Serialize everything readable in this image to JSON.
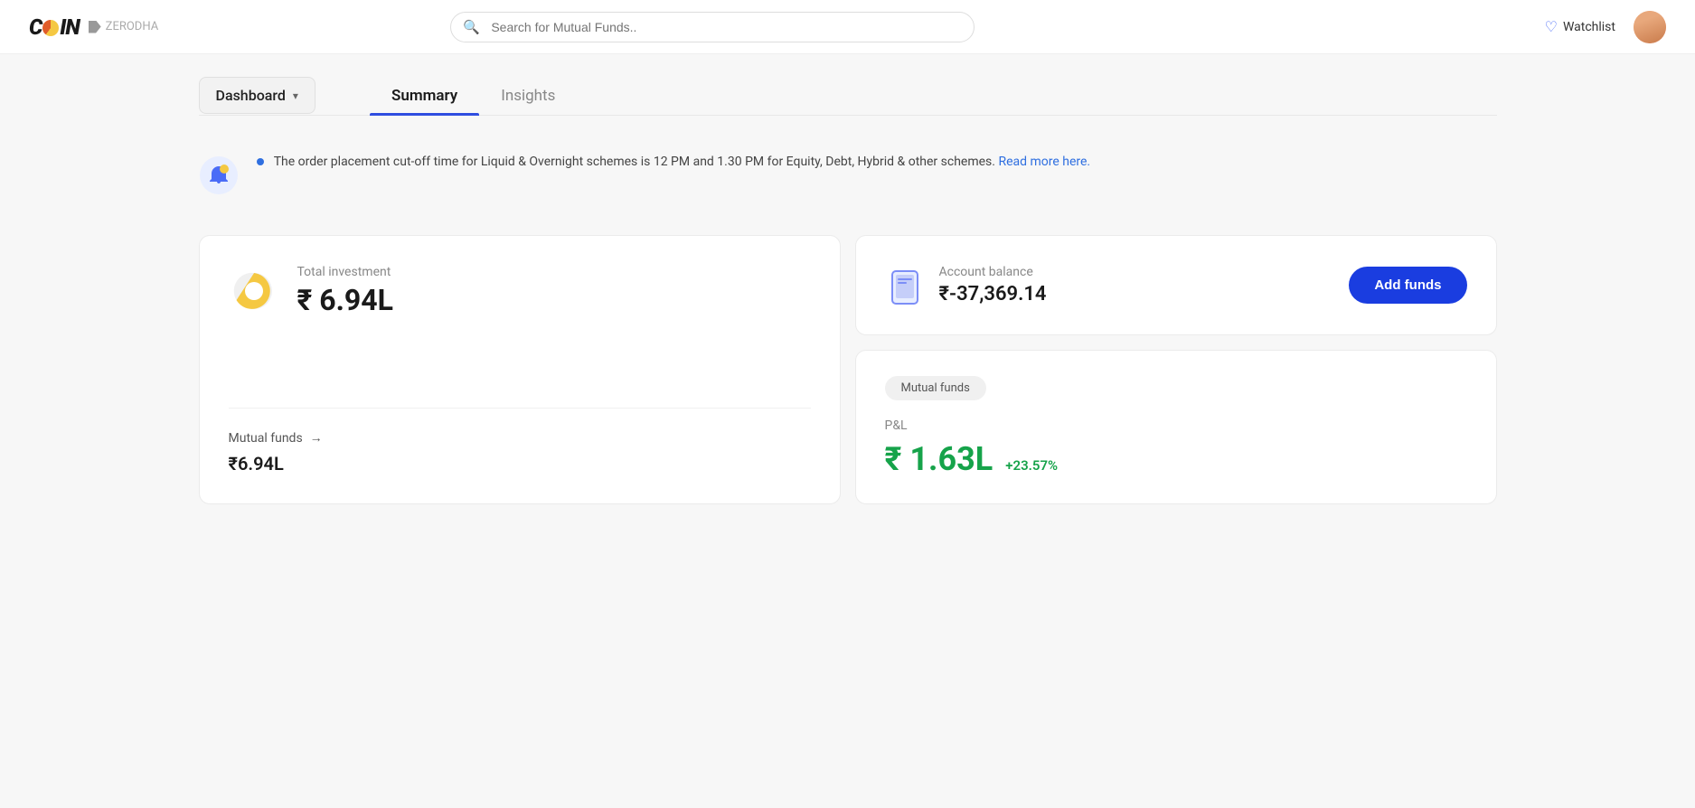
{
  "header": {
    "logo": {
      "coin_text": "COIN",
      "zerodha_text": "ZERODHA"
    },
    "search": {
      "placeholder": "Search for Mutual Funds.."
    },
    "watchlist_label": "Watchlist"
  },
  "tabs": {
    "dashboard_label": "Dashboard",
    "summary_label": "Summary",
    "insights_label": "Insights"
  },
  "notification": {
    "text": "The order placement cut-off time for Liquid & Overnight schemes is 12 PM and 1.30 PM for Equity, Debt, Hybrid & other schemes.",
    "link_text": "Read more here."
  },
  "investment_card": {
    "label": "Total investment",
    "amount": "₹ 6.94L",
    "mutual_funds_label": "Mutual funds",
    "mutual_funds_arrow": "→",
    "mutual_funds_amount": "₹6.94L"
  },
  "account_card": {
    "label": "Account balance",
    "amount": "₹-37,369.14",
    "add_funds_label": "Add funds"
  },
  "pnl_card": {
    "badge_label": "Mutual funds",
    "pnl_label": "P&L",
    "pnl_amount": "₹ 1.63L",
    "pnl_percent": "+23.57%"
  }
}
